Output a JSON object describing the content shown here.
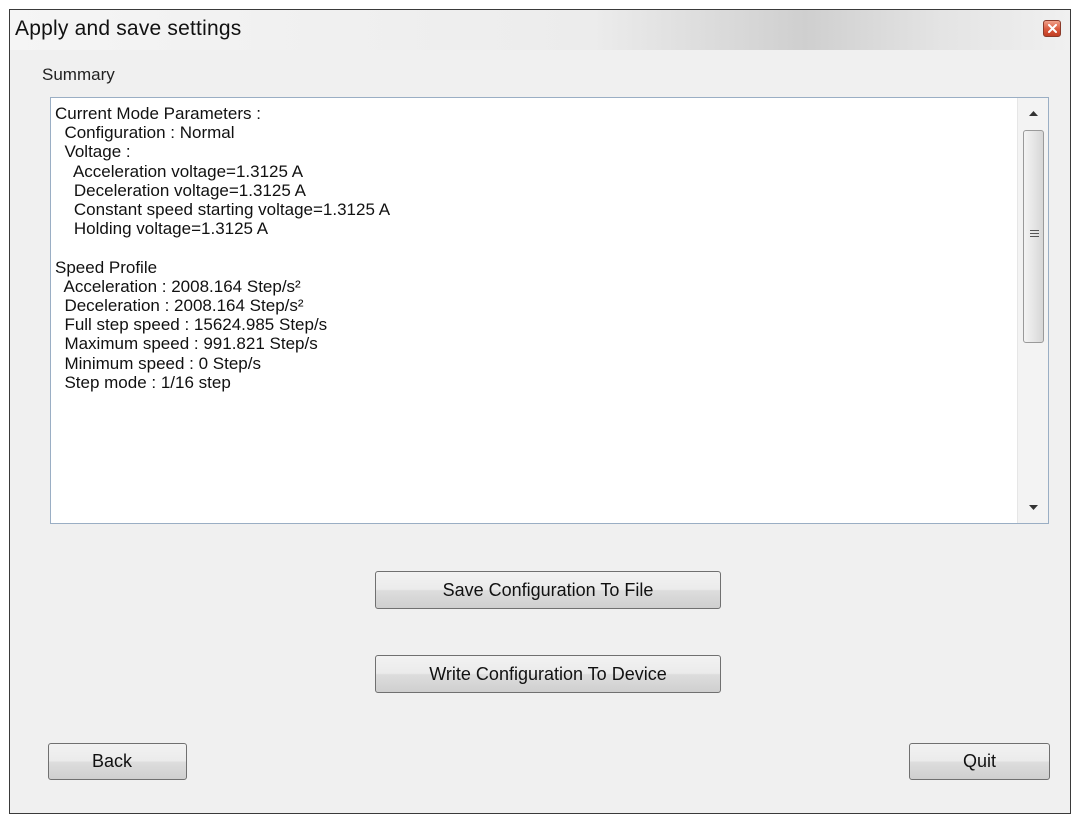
{
  "window": {
    "title": "Apply and save settings"
  },
  "summary": {
    "label": "Summary",
    "lines": [
      "Current Mode Parameters :",
      "  Configuration : Normal",
      "  Voltage :",
      "    Acceleration voltage=1.3125 A",
      "    Deceleration voltage=1.3125 A",
      "    Constant speed starting voltage=1.3125 A",
      "    Holding voltage=1.3125 A",
      "",
      "Speed Profile",
      "  Acceleration : 2008.164 Step/s²",
      "  Deceleration : 2008.164 Step/s²",
      "  Full step speed : 15624.985 Step/s",
      "  Maximum speed : 991.821 Step/s",
      "  Minimum speed : 0 Step/s",
      "  Step mode : 1/16 step"
    ]
  },
  "buttons": {
    "save_file": "Save Configuration To File",
    "write_device": "Write Configuration To Device",
    "back": "Back",
    "quit": "Quit"
  },
  "icons": {
    "close": "close-icon",
    "scroll_up": "arrow-up-icon",
    "scroll_down": "arrow-down-icon",
    "thumb_grip": "grip-icon"
  },
  "colors": {
    "close_button": "#d9583c",
    "textbox_border": "#9aaec4",
    "window_background": "#f0f0f0"
  }
}
